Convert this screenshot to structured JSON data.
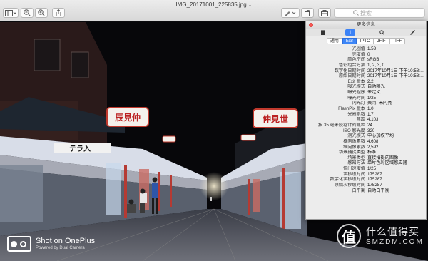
{
  "window": {
    "title": "IMG_20171001_225835.jpg",
    "title_chevron": "⌄",
    "search_placeholder": "搜索"
  },
  "inspector": {
    "title": "更多信息",
    "icon_info_label": "i",
    "tabs": [
      "通用",
      "Exif",
      "IPTC",
      "JFIF",
      "TIFF"
    ],
    "selected_tab": "Exif",
    "rows": [
      {
        "k": "光圈值",
        "v": "1.53"
      },
      {
        "k": "亮度值",
        "v": "0"
      },
      {
        "k": "颜色空间",
        "v": "sRGB"
      },
      {
        "k": "色彩组合方案",
        "v": "1, 2, 3, 0"
      },
      {
        "k": "数字化日期时间",
        "v": "2017年10月1日 下午10:58:…"
      },
      {
        "k": "原始日期时间",
        "v": "2017年10月1日 下午10:58:…"
      },
      {
        "k": "Exif 版本",
        "v": "2.2"
      },
      {
        "k": "曝光模式",
        "v": "自动曝光"
      },
      {
        "k": "曝光程序",
        "v": "未定义"
      },
      {
        "k": "曝光时间",
        "v": "1/25"
      },
      {
        "k": "闪光灯",
        "v": "关闭, 未闪亮"
      },
      {
        "k": "FlashPix 版本",
        "v": "1.0"
      },
      {
        "k": "光圈系数",
        "v": "1.7"
      },
      {
        "k": "焦距",
        "v": "4.103"
      },
      {
        "k": "按 35 毫米胶卷计的焦距",
        "v": "24"
      },
      {
        "k": "ISO 感光度",
        "v": "320"
      },
      {
        "k": "测光模式",
        "v": "中心加权平均"
      },
      {
        "k": "横向像素数",
        "v": "4,608"
      },
      {
        "k": "纵向像素数",
        "v": "2,592"
      },
      {
        "k": "场景捕捉类型",
        "v": "标准"
      },
      {
        "k": "场景类型",
        "v": "直接拍摄的图像"
      },
      {
        "k": "感知方法",
        "v": "单片色彩区域感应器"
      },
      {
        "k": "快门速度值",
        "v": "1/25"
      },
      {
        "k": "次秒级时间",
        "v": "175287"
      },
      {
        "k": "数字化次秒级时间",
        "v": "175287"
      },
      {
        "k": "原始次秒级时间",
        "v": "175287"
      },
      {
        "k": "白平衡",
        "v": "自动白平衡"
      }
    ]
  },
  "photo": {
    "lantern_left_text": "⾠⾒仲",
    "lantern_right_text": "仲見世",
    "sign_left_text": "テラ入",
    "watermark_line1": "Shot on OnePlus",
    "watermark_line2": "Powered by Dual Camera",
    "smzdm_badge": "值",
    "smzdm_line1": "什么值得买",
    "smzdm_line2": "SMZDM.COM"
  },
  "colors": {
    "accent_blue": "#3d86f7",
    "close_red": "#fc5753"
  }
}
